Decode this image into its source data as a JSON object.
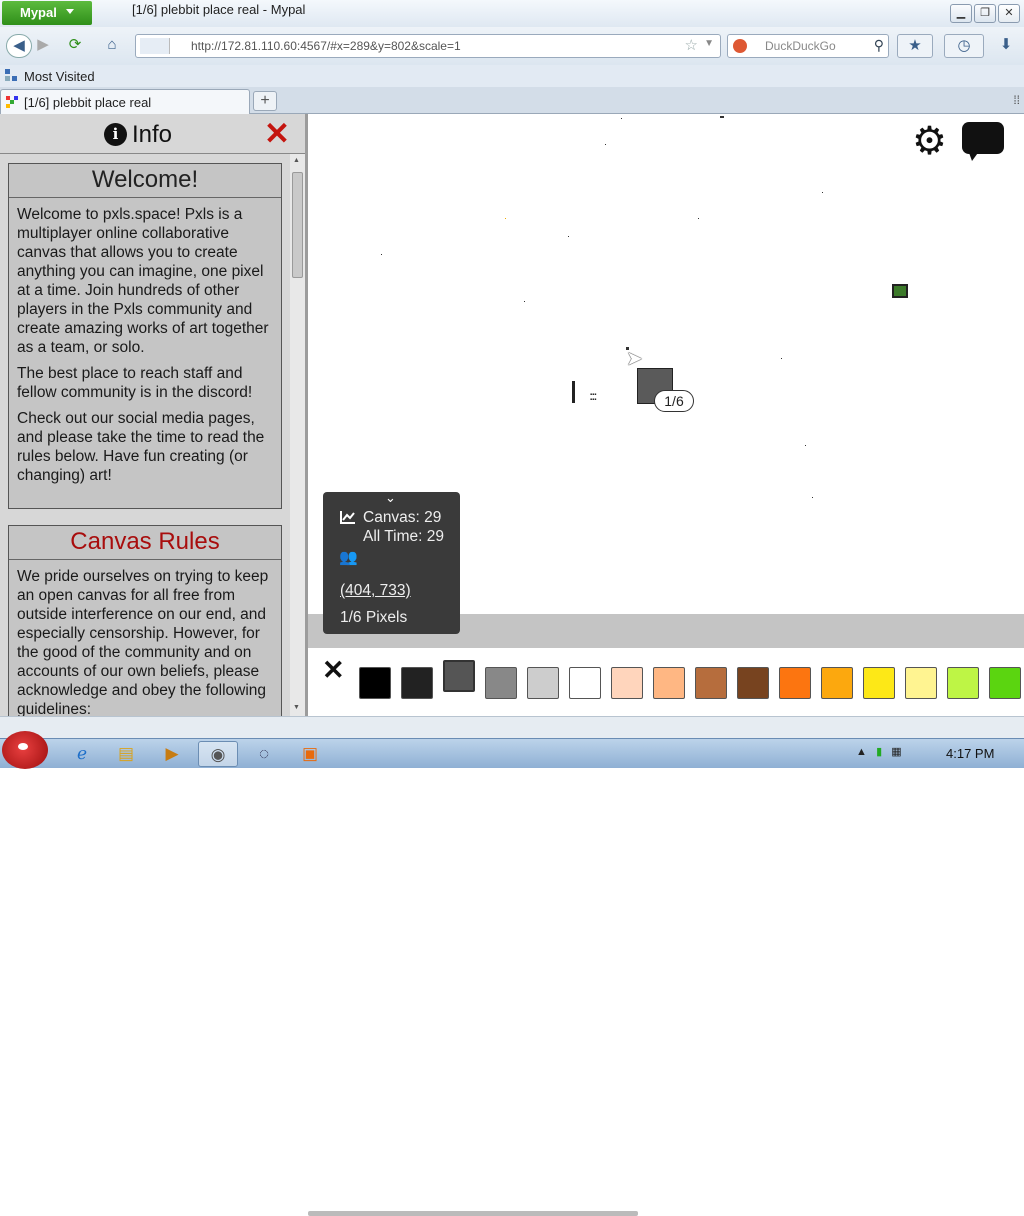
{
  "window": {
    "app_menu_label": "Mypal",
    "title": "[1/6] plebbit place real - Mypal"
  },
  "toolbar": {
    "url": "http://172.81.110.60:4567/#x=289&y=802&scale=1",
    "search_placeholder": "DuckDuckGo"
  },
  "bookmarks": {
    "most_visited": "Most Visited"
  },
  "tabs": [
    {
      "label": "[1/6] plebbit place real"
    }
  ],
  "info_panel": {
    "title": "Info",
    "welcome": {
      "heading": "Welcome!",
      "paragraphs": [
        "Welcome to pxls.space! Pxls is a multiplayer online collaborative canvas that allows you to create anything you can imagine, one pixel at a time. Join hundreds of other players in the Pxls community and create amazing works of art together as a team, or solo.",
        "The best place to reach staff and fellow community is in the discord!",
        "Check out our social media pages, and please take the time to read the rules below. Have fun creating (or changing) art!"
      ]
    },
    "rules": {
      "heading": "Canvas Rules",
      "paragraphs": [
        "We pride ourselves on trying to keep an open canvas for all free from outside interference on our end, and especially censorship. However, for the good of the community and on accounts of our own beliefs, please acknowledge and obey the following guidelines:"
      ]
    }
  },
  "canvas": {
    "pixel_badge": "1/6",
    "stats": {
      "canvas_label": "Canvas: 29",
      "alltime_label": "All Time: 29",
      "coords": "(404, 733)",
      "pixels": "1/6 Pixels"
    },
    "palette": {
      "colors": [
        "#000000",
        "#222222",
        "#555555",
        "#888888",
        "#cdcdcd",
        "#ffffff",
        "#ffd5bc",
        "#ffb783",
        "#b66d3d",
        "#77431f",
        "#fc7510",
        "#fca80e",
        "#fde817",
        "#fff491",
        "#bef545",
        "#5bd510"
      ],
      "selected_index": 2
    }
  },
  "taskbar": {
    "clock": "4:17 PM"
  },
  "icons": [
    "back-arrow-icon",
    "forward-arrow-icon",
    "reload-icon",
    "home-icon",
    "info-icon",
    "close-icon",
    "settings-gear-icon",
    "chat-bubble-icon",
    "chart-icon",
    "users-icon",
    "search-icon",
    "star-icon",
    "download-icon",
    "history-icon"
  ]
}
